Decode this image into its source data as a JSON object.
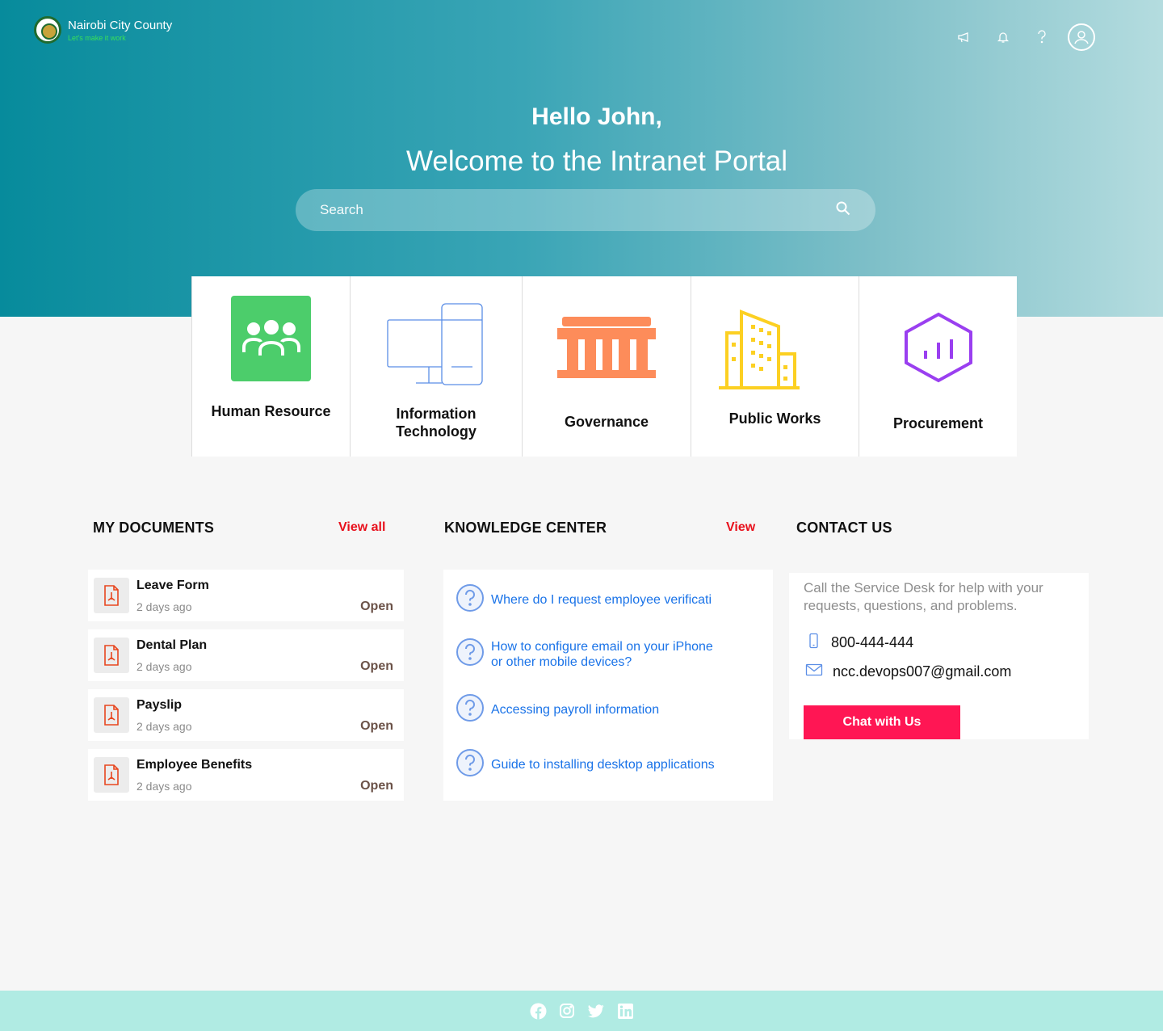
{
  "brand": {
    "name": "Nairobi City County",
    "tagline": "Let's make it work"
  },
  "header_icons": [
    "megaphone-icon",
    "bell-icon",
    "help-icon",
    "user-avatar-icon"
  ],
  "greeting": "Hello John,",
  "welcome": "Welcome to the Intranet Portal",
  "search": {
    "placeholder": "Search"
  },
  "departments": [
    {
      "label": "Human Resource",
      "icon": "people-icon",
      "color": "#4ccd6b"
    },
    {
      "label": "Information Technology",
      "icon": "computer-icon",
      "color": "#5b8ee6"
    },
    {
      "label": "Governance",
      "icon": "government-building-icon",
      "color": "#fd8c5a"
    },
    {
      "label": "Public Works",
      "icon": "city-buildings-icon",
      "color": "#fcd022"
    },
    {
      "label": "Procurement",
      "icon": "hexagon-chart-icon",
      "color": "#9a3ff0"
    }
  ],
  "documents": {
    "title": "MY DOCUMENTS",
    "view_all": "View all",
    "items": [
      {
        "name": "Leave Form",
        "time": "2 days ago",
        "action": "Open"
      },
      {
        "name": "Dental Plan",
        "time": "2 days ago",
        "action": "Open"
      },
      {
        "name": "Payslip",
        "time": "2 days ago",
        "action": "Open"
      },
      {
        "name": "Employee Benefits",
        "time": "2 days ago",
        "action": "Open"
      }
    ]
  },
  "knowledge": {
    "title": "KNOWLEDGE CENTER",
    "view": "View",
    "items": [
      {
        "line1": "Where do I request employee verificati",
        "line2": ""
      },
      {
        "line1": "How to configure email on your iPhone",
        "line2": "or other mobile devices?"
      },
      {
        "line1": "Accessing payroll information",
        "line2": ""
      },
      {
        "line1": "Guide to installing desktop applications",
        "line2": ""
      }
    ]
  },
  "contact": {
    "title": "CONTACT US",
    "description": "Call the Service Desk for help with your requests, questions, and problems.",
    "phone": "800-444-444",
    "email": "ncc.devops007@gmail.com",
    "chat_button": "Chat with Us"
  },
  "footer": {
    "social": [
      "facebook-icon",
      "instagram-icon",
      "twitter-icon",
      "linkedin-icon"
    ]
  },
  "colors": {
    "accent_red": "#e8101c",
    "chat_button": "#ff1654",
    "link_blue": "#1a73e8",
    "footer_bg": "#b0ebe3"
  }
}
